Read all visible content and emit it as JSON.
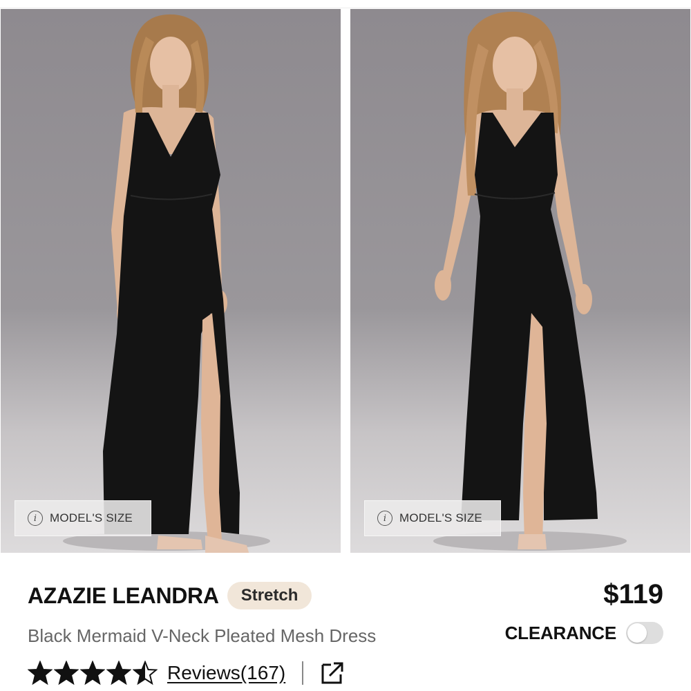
{
  "product": {
    "brand": "AZAZIE LEANDRA",
    "badge": "Stretch",
    "price": "$119",
    "subtitle": "Black Mermaid V-Neck Pleated Mesh Dress",
    "clearance_label": "CLEARANCE",
    "clearance_toggle_on": false,
    "rating": 4.5,
    "reviews_label": "Reviews(167)"
  },
  "photos": [
    {
      "chip_label": "MODEL'S SIZE",
      "chip_icon": "info-icon"
    },
    {
      "chip_label": "MODEL'S SIZE",
      "chip_icon": "info-icon"
    }
  ],
  "icons": {
    "star": "star-icon",
    "external_link": "external-link-icon"
  },
  "colors": {
    "badge_bg": "#f1e6d9",
    "dress": "#111111",
    "photo_bg": "#9a979b"
  }
}
